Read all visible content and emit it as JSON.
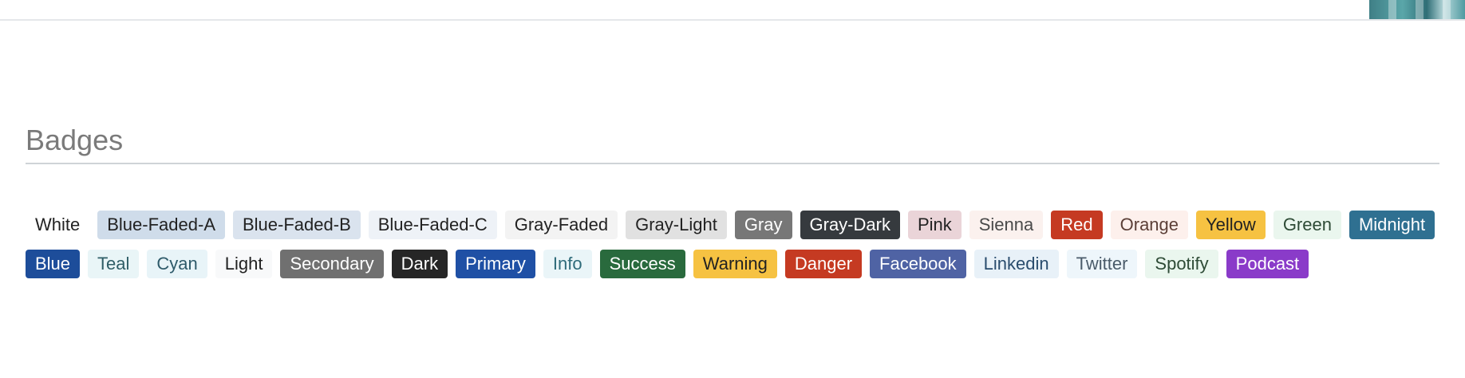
{
  "section": {
    "title": "Badges"
  },
  "badges": [
    {
      "label": "White",
      "bg": "#ffffff",
      "fg": "#222222"
    },
    {
      "label": "Blue-Faded-A",
      "bg": "#cfdcea",
      "fg": "#222222"
    },
    {
      "label": "Blue-Faded-B",
      "bg": "#dae3ee",
      "fg": "#222222"
    },
    {
      "label": "Blue-Faded-C",
      "bg": "#eef2f7",
      "fg": "#222222"
    },
    {
      "label": "Gray-Faded",
      "bg": "#f3f3f3",
      "fg": "#222222"
    },
    {
      "label": "Gray-Light",
      "bg": "#e1e1e1",
      "fg": "#222222"
    },
    {
      "label": "Gray",
      "bg": "#777777",
      "fg": "#ffffff"
    },
    {
      "label": "Gray-Dark",
      "bg": "#363a3e",
      "fg": "#ffffff"
    },
    {
      "label": "Pink",
      "bg": "#ead4d8",
      "fg": "#222222"
    },
    {
      "label": "Sienna",
      "bg": "#fbf1ee",
      "fg": "#4a4a4a"
    },
    {
      "label": "Red",
      "bg": "#c53a22",
      "fg": "#ffffff"
    },
    {
      "label": "Orange",
      "bg": "#fdf0ec",
      "fg": "#5b3f37"
    },
    {
      "label": "Yellow",
      "bg": "#f6c242",
      "fg": "#222222"
    },
    {
      "label": "Green",
      "bg": "#eaf6ee",
      "fg": "#2e4b36"
    },
    {
      "label": "Midnight",
      "bg": "#2f7091",
      "fg": "#ffffff"
    },
    {
      "label": "Blue",
      "bg": "#1d4d9a",
      "fg": "#ffffff"
    },
    {
      "label": "Teal",
      "bg": "#e9f5f7",
      "fg": "#2f5e67"
    },
    {
      "label": "Cyan",
      "bg": "#e8f4f8",
      "fg": "#2e5a6a"
    },
    {
      "label": "Light",
      "bg": "#f8f9fa",
      "fg": "#222222"
    },
    {
      "label": "Secondary",
      "bg": "#707070",
      "fg": "#ffffff"
    },
    {
      "label": "Dark",
      "bg": "#262626",
      "fg": "#ffffff"
    },
    {
      "label": "Primary",
      "bg": "#1f50a5",
      "fg": "#ffffff"
    },
    {
      "label": "Info",
      "bg": "#eaf5f8",
      "fg": "#2f6b7a"
    },
    {
      "label": "Success",
      "bg": "#296a3d",
      "fg": "#ffffff"
    },
    {
      "label": "Warning",
      "bg": "#f6c242",
      "fg": "#222222"
    },
    {
      "label": "Danger",
      "bg": "#c53a22",
      "fg": "#ffffff"
    },
    {
      "label": "Facebook",
      "bg": "#4f63a4",
      "fg": "#ffffff"
    },
    {
      "label": "Linkedin",
      "bg": "#e8f1f8",
      "fg": "#2a4d6e"
    },
    {
      "label": "Twitter",
      "bg": "#eef6fb",
      "fg": "#4a5b6a"
    },
    {
      "label": "Spotify",
      "bg": "#eaf6ee",
      "fg": "#2e4b36"
    },
    {
      "label": "Podcast",
      "bg": "#8a3bc9",
      "fg": "#ffffff"
    }
  ]
}
